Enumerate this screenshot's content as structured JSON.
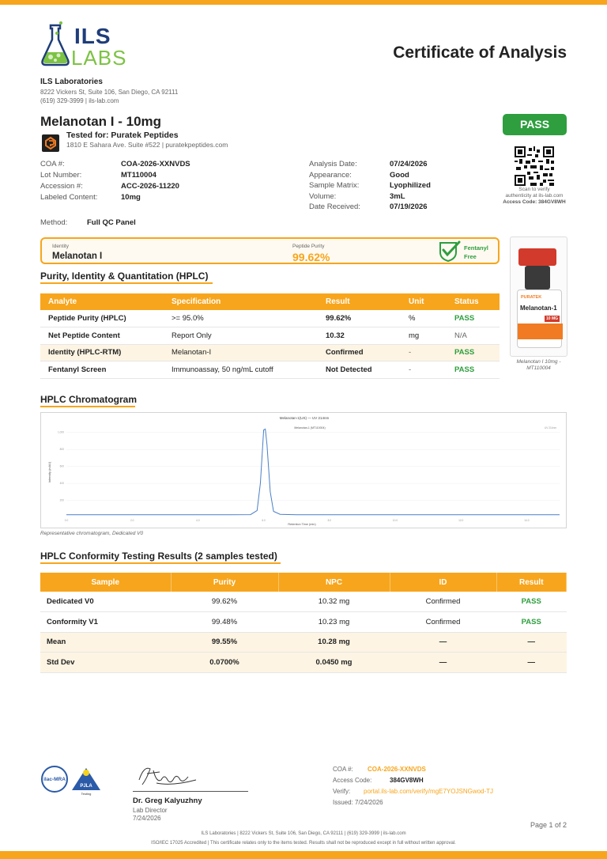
{
  "header": {
    "logo_ils": "ILS",
    "logo_labs": "LABS",
    "doc_title": "Certificate of Analysis"
  },
  "lab": {
    "name": "ILS Laboratories",
    "address": "8222 Vickers St, Suite 106, San Diego, CA 92111",
    "contact": "(619) 329-3999  |  ils-lab.com"
  },
  "product": {
    "title": "Melanotan I - 10mg",
    "tested_for": "Tested for: Puratek Peptides",
    "client_address": "1810 E Sahara Ave. Suite #522  |  puratekpeptides.com",
    "result_badge": "PASS"
  },
  "details_left": [
    {
      "label": "COA #:",
      "value": "COA-2026-XXNVDS"
    },
    {
      "label": "Lot Number:",
      "value": "MT110004"
    },
    {
      "label": "Accession #:",
      "value": "ACC-2026-11220"
    },
    {
      "label": "Labeled Content:",
      "value": "10mg"
    }
  ],
  "details_right": [
    {
      "label": "Analysis Date:",
      "value": "07/24/2026"
    },
    {
      "label": "Appearance:",
      "value": "Good"
    },
    {
      "label": "Sample Matrix:",
      "value": "Lyophilized"
    },
    {
      "label": "Volume:",
      "value": "3mL"
    },
    {
      "label": "Date Received:",
      "value": "07/19/2026"
    }
  ],
  "qr": {
    "scan_text": "Scan to verify",
    "auth_text": "authenticity at ils-lab.com",
    "access_code": "Access Code: 384GV8WH"
  },
  "method": {
    "label": "Method:",
    "value": "Full QC Panel"
  },
  "summary": {
    "identity_label": "Identity",
    "identity_value": "Melanotan I",
    "purity_label": "Peptide Purity",
    "purity_value": "99.62%",
    "fentanyl_line1": "Fentanyl",
    "fentanyl_line2": "Free"
  },
  "product_image": {
    "brand": "PURATEK",
    "name": "Melanotan-1",
    "dose": "10 MG",
    "caption_line1": "Melanotan I 10mg -",
    "caption_line2": "MT110004"
  },
  "hplc_section": {
    "title": "Purity, Identity & Quantitation (HPLC)",
    "columns": [
      "Analyte",
      "Specification",
      "Result",
      "Unit",
      "Status"
    ],
    "rows": [
      {
        "analyte": "Peptide Purity (HPLC)",
        "spec": ">= 95.0%",
        "result": "99.62%",
        "unit": "%",
        "status": "PASS"
      },
      {
        "analyte": "Net Peptide Content",
        "spec": "Report Only",
        "result": "10.32",
        "unit": "mg",
        "status": "N/A"
      },
      {
        "analyte": "Identity (HPLC-RTM)",
        "spec": "Melanotan-I",
        "result": "Confirmed",
        "unit": "-",
        "status": "PASS"
      },
      {
        "analyte": "Fentanyl Screen",
        "spec": "Immunoassay, 50 ng/mL cutoff",
        "result": "Not Detected",
        "unit": "-",
        "status": "PASS"
      }
    ]
  },
  "chromatogram": {
    "title": "HPLC Chromatogram",
    "plot_title": "Melanotan-1(US) — UV 214nm",
    "peak_label": "Melanotan-1 (MT110004)",
    "legend": "UV 214nm",
    "xlabel": "Retention Time (min)",
    "ylabel": "Intensity (mAU)",
    "yticks": [
      "1,000",
      "800",
      "600",
      "400",
      "200"
    ],
    "xticks": [
      "0.0",
      "2.0",
      "4.0",
      "6.0",
      "8.0",
      "10.0",
      "12.0",
      "14.0"
    ],
    "caption": "Representative chromatogram, Dedicated V0"
  },
  "conformity": {
    "title": "HPLC Conformity Testing Results (2 samples tested)",
    "columns": [
      "Sample",
      "Purity",
      "NPC",
      "ID",
      "Result"
    ],
    "rows": [
      {
        "sample": "Dedicated V0",
        "purity": "99.62%",
        "npc": "10.32 mg",
        "id": "Confirmed",
        "result": "PASS"
      },
      {
        "sample": "Conformity V1",
        "purity": "99.48%",
        "npc": "10.23 mg",
        "id": "Confirmed",
        "result": "PASS"
      },
      {
        "sample": "Mean",
        "purity": "99.55%",
        "npc": "10.28 mg",
        "id": "—",
        "result": "—"
      },
      {
        "sample": "Std Dev",
        "purity": "0.0700%",
        "npc": "0.0450 mg",
        "id": "—",
        "result": "—"
      }
    ]
  },
  "accreditation": {
    "ilac": "ilac-MRA",
    "pjla": "PJLA",
    "pjla_sub": "Testing"
  },
  "signature": {
    "name": "Dr. Greg Kalyuzhny",
    "role": "Lab Director",
    "date": "7/24/2026"
  },
  "verify": {
    "coa_label": "COA #:",
    "coa_value": "COA-2026-XXNVDS",
    "access_label": "Access Code:",
    "access_value": "384GV8WH",
    "verify_label": "Verify:",
    "verify_link": "portal.ils-lab.com/verify/mgE7YOJSNGwod-TJ",
    "issued": "Issued: 7/24/2026"
  },
  "footer": {
    "page": "Page 1 of 2",
    "line1": "ILS Laboratories  |  8222 Vickers St, Suite 106, San Diego, CA 92111  |  (619) 329-3999  |  ils-lab.com",
    "line2": "ISO/IEC 17025 Accredited  |  This certificate relates only to the items tested. Results shall not be reproduced except in full without written approval."
  },
  "chart_data": {
    "type": "line",
    "title": "Melanotan-1(US) — UV 214nm",
    "xlabel": "Retention Time (min)",
    "ylabel": "Intensity (mAU)",
    "xlim": [
      0,
      15
    ],
    "ylim": [
      0,
      1100
    ],
    "series": [
      {
        "name": "UV 214nm",
        "x": [
          0,
          1,
          2,
          3,
          4,
          5,
          5.6,
          5.8,
          5.9,
          6.0,
          6.05,
          6.1,
          6.2,
          6.3,
          6.5,
          7,
          8,
          9,
          10,
          11,
          12,
          13,
          14,
          15
        ],
        "y": [
          30,
          30,
          30,
          30,
          30,
          30,
          32,
          80,
          400,
          1030,
          1040,
          860,
          300,
          70,
          35,
          30,
          30,
          30,
          30,
          30,
          30,
          30,
          30,
          30
        ]
      }
    ]
  }
}
